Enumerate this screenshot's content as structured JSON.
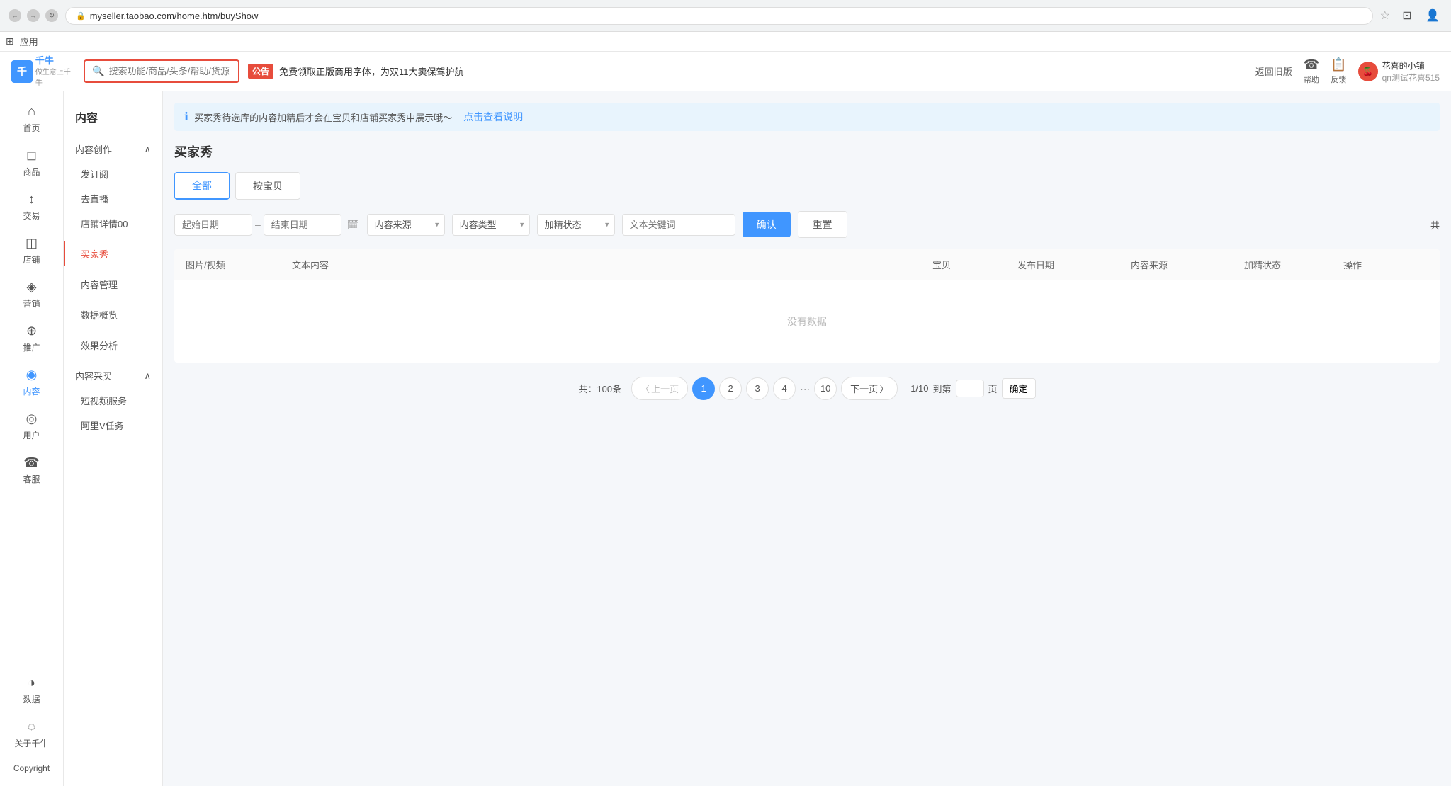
{
  "browser": {
    "url": "myseller.taobao.com/home.htm/buyShow",
    "back_btn": "←",
    "forward_btn": "→",
    "refresh_btn": "↻"
  },
  "topbar": {
    "logo": "千牛",
    "logo_sub": "做生意上千牛",
    "search_placeholder": "搜索功能/商品/头条/帮助/货源",
    "notice_badge": "公告",
    "notice_text": "免费领取正版商用字体，为双11大卖保驾护航",
    "back_old": "返回旧版",
    "help_label": "帮助",
    "feedback_label": "反馈",
    "user_name": "花喜的小铺",
    "user_sub": "qn测试花喜515"
  },
  "apps_bar": {
    "icon": "⊞",
    "label": "应用"
  },
  "sidebar": {
    "items": [
      {
        "icon": "⌂",
        "label": "首页"
      },
      {
        "icon": "◻",
        "label": "商品"
      },
      {
        "icon": "↕",
        "label": "交易"
      },
      {
        "icon": "◫",
        "label": "店铺"
      },
      {
        "icon": "◈",
        "label": "营销"
      },
      {
        "icon": "⊕",
        "label": "推广"
      },
      {
        "icon": "◉",
        "label": "内容",
        "active": true
      },
      {
        "icon": "◎",
        "label": "用户"
      },
      {
        "icon": "☎",
        "label": "客服"
      }
    ],
    "bottom_items": [
      {
        "icon": "◑",
        "label": "数据"
      },
      {
        "icon": "◌",
        "label": "关于千牛"
      },
      {
        "icon": "©",
        "label": "Copyright"
      }
    ]
  },
  "secondary_sidebar": {
    "title": "内容",
    "sections": [
      {
        "label": "内容创作",
        "expanded": true,
        "items": [
          "发订阅",
          "去直播",
          "店铺详情00"
        ]
      },
      {
        "label": "买家秀",
        "active_item": "买家秀",
        "items": []
      },
      {
        "label": "内容管理",
        "items": []
      },
      {
        "label": "数据概览",
        "items": []
      },
      {
        "label": "效果分析",
        "items": []
      },
      {
        "label": "内容采买",
        "expanded": true,
        "items": [
          "短视频服务",
          "阿里V任务"
        ]
      }
    ]
  },
  "content": {
    "info_banner": "买家秀待选库的内容加精后才会在宝贝和店铺买家秀中展示哦～",
    "info_link": "点击查看说明",
    "page_title": "买家秀",
    "tabs": [
      {
        "label": "全部",
        "active": true
      },
      {
        "label": "按宝贝"
      }
    ],
    "filters": {
      "start_date": "起始日期",
      "end_date": "结束日期",
      "source_label": "内容来源",
      "type_label": "内容类型",
      "status_label": "加精状态",
      "keyword_placeholder": "文本关键词",
      "confirm_btn": "确认",
      "reset_btn": "重置",
      "share_btn": "共"
    },
    "table": {
      "headers": [
        "图片/视频",
        "文本内容",
        "宝贝",
        "发布日期",
        "内容来源",
        "加精状态",
        "操作"
      ],
      "empty_text": "没有数据"
    },
    "pagination": {
      "total": "共：100条",
      "prev_btn": "〈 上一页",
      "next_btn": "下一页 〉",
      "pages": [
        "1",
        "2",
        "3",
        "4",
        "...",
        "10"
      ],
      "active_page": "1",
      "goto_label": "1/10",
      "goto_prefix": "到第",
      "goto_suffix": "页",
      "confirm_goto": "确定"
    }
  }
}
